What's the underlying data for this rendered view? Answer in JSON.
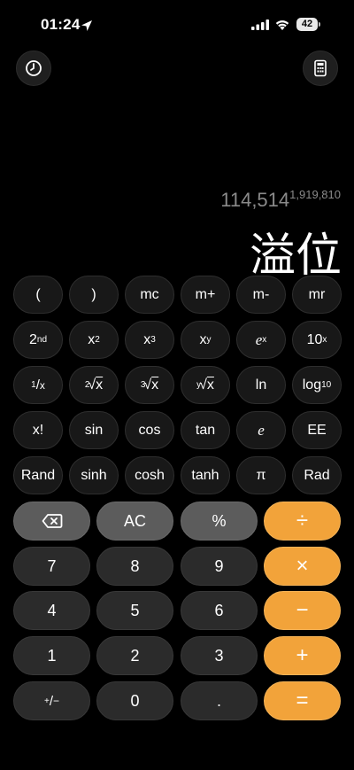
{
  "status_bar": {
    "time": "01:24",
    "battery": "42"
  },
  "display": {
    "expression_base": "114,514",
    "expression_exponent": "1,919,810",
    "result": "溢位"
  },
  "keys": {
    "row1": [
      "(",
      ")",
      "mc",
      "m+",
      "m-",
      "mr"
    ],
    "row2": {
      "second": {
        "base": "2",
        "sup": "nd"
      },
      "x_squared": {
        "base": "x",
        "sup": "2"
      },
      "x_cubed": {
        "base": "x",
        "sup": "3"
      },
      "x_power_y": {
        "base": "x",
        "sup": "y"
      },
      "e_power_x": {
        "base": "e",
        "sup": "x"
      },
      "ten_power_x": {
        "base": "10",
        "sup": "x"
      }
    },
    "row3": {
      "reciprocal": {
        "num": "1",
        "slash": "/",
        "den": "x"
      },
      "sqrt2": {
        "index": "2",
        "sign": "√",
        "arg": "x"
      },
      "sqrt3": {
        "index": "3",
        "sign": "√",
        "arg": "x"
      },
      "sqrty": {
        "index": "y",
        "sign": "√",
        "arg": "x"
      },
      "ln": "ln",
      "log10": {
        "base": "log",
        "sub": "10"
      }
    },
    "row4": [
      "x!",
      "sin",
      "cos",
      "tan",
      "e",
      "EE"
    ],
    "row5": [
      "Rand",
      "sinh",
      "cosh",
      "tanh",
      "π",
      "Rad"
    ],
    "func": {
      "ac": "AC",
      "percent": "%"
    },
    "operators": {
      "divide": "÷",
      "multiply": "×",
      "minus": "−",
      "plus": "+",
      "equals": "="
    },
    "digits": {
      "7": "7",
      "8": "8",
      "9": "9",
      "4": "4",
      "5": "5",
      "6": "6",
      "1": "1",
      "2": "2",
      "3": "3",
      "0": "0",
      "decimal": "."
    },
    "sign_toggle": {
      "plus": "+",
      "slash": "/",
      "minus": "−"
    }
  },
  "colors": {
    "background": "#000000",
    "operator": "#f2a33a",
    "function_key": "#5c5c5c",
    "number_key": "#2b2b2b",
    "scientific_key": "#181818"
  },
  "icons": [
    "location-arrow-icon",
    "signal-icon",
    "wifi-icon",
    "battery-icon",
    "history-icon",
    "calculator-icon",
    "backspace-icon"
  ]
}
